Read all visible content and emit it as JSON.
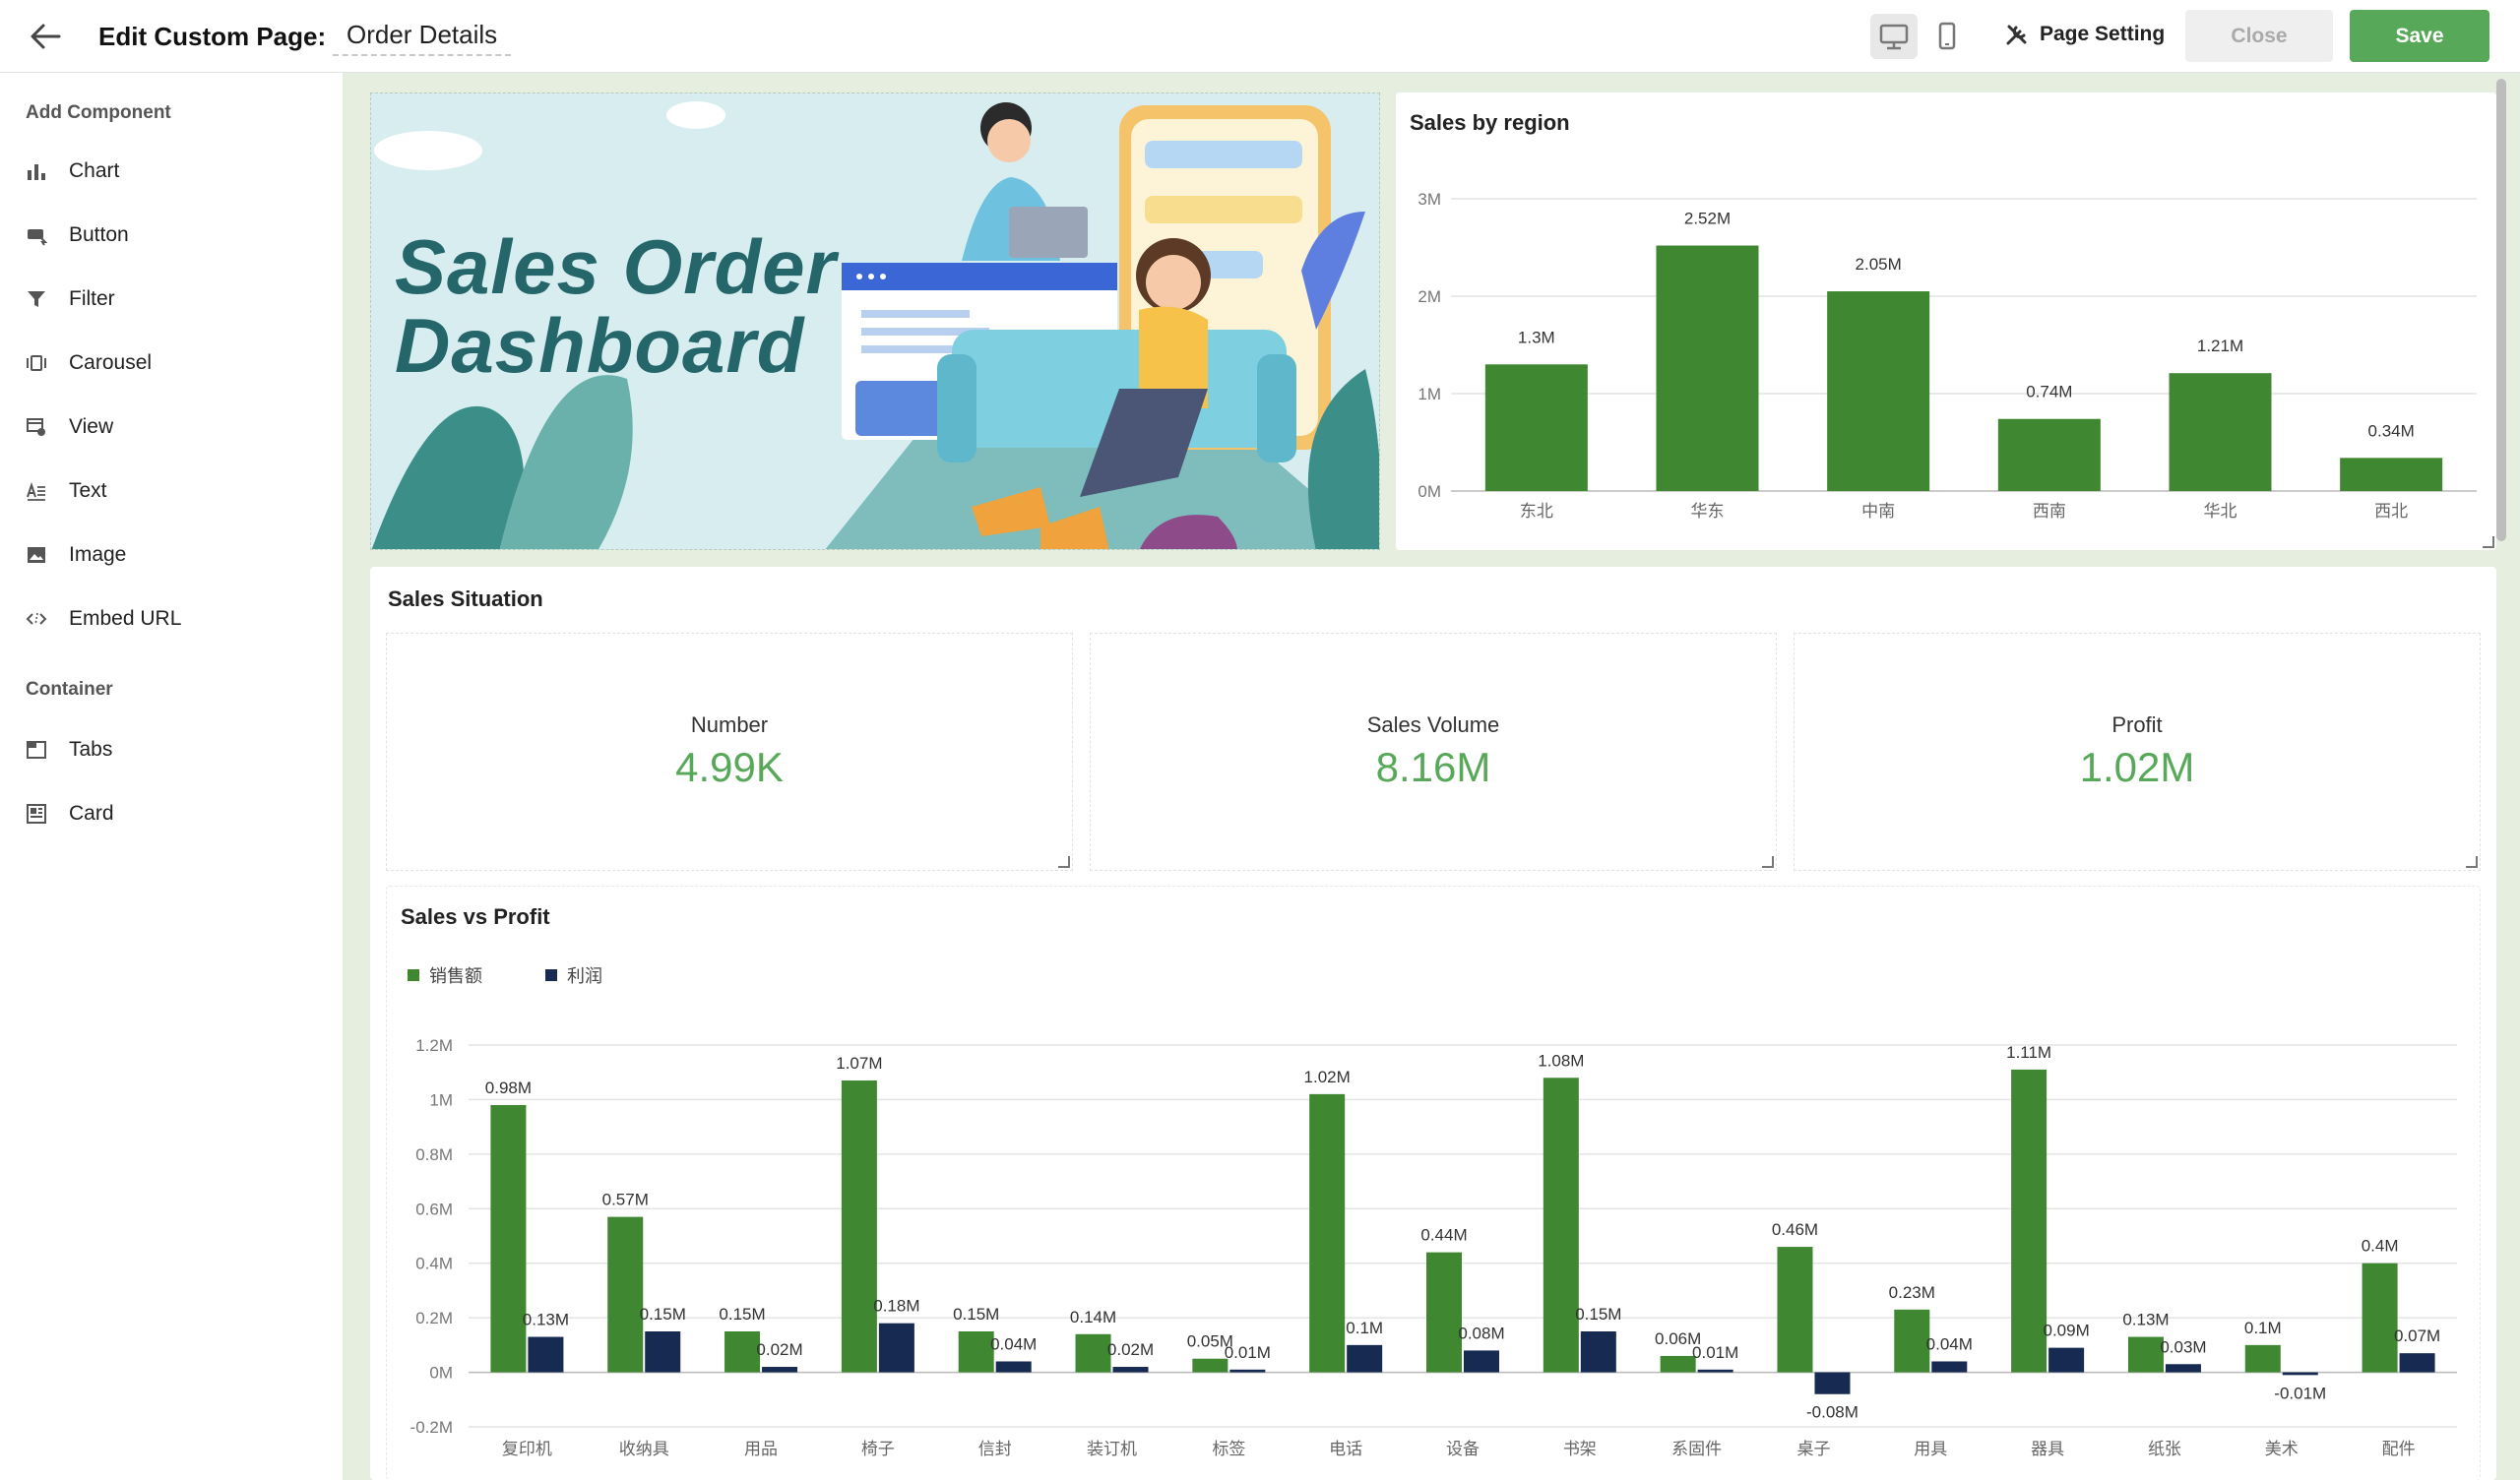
{
  "header": {
    "title_label": "Edit Custom Page:",
    "page_name": "Order Details",
    "page_setting_label": "Page Setting",
    "close_label": "Close",
    "save_label": "Save",
    "device_icons": [
      "desktop-icon",
      "mobile-icon"
    ]
  },
  "sidebar": {
    "add_component_heading": "Add Component",
    "components": [
      {
        "label": "Chart",
        "icon": "bar-chart-icon"
      },
      {
        "label": "Button",
        "icon": "button-icon"
      },
      {
        "label": "Filter",
        "icon": "filter-icon"
      },
      {
        "label": "Carousel",
        "icon": "carousel-icon"
      },
      {
        "label": "View",
        "icon": "view-icon"
      },
      {
        "label": "Text",
        "icon": "text-icon"
      },
      {
        "label": "Image",
        "icon": "image-icon"
      },
      {
        "label": "Embed URL",
        "icon": "code-icon"
      }
    ],
    "container_heading": "Container",
    "containers": [
      {
        "label": "Tabs",
        "icon": "tabs-icon"
      },
      {
        "label": "Card",
        "icon": "card-icon"
      }
    ]
  },
  "banner": {
    "title_line1": "Sales Order",
    "title_line2": "Dashboard"
  },
  "sales_situation": {
    "title": "Sales Situation",
    "metrics": [
      {
        "label": "Number",
        "value": "4.99K"
      },
      {
        "label": "Sales Volume",
        "value": "8.16M"
      },
      {
        "label": "Profit",
        "value": "1.02M"
      }
    ]
  },
  "colors": {
    "accent_green": "#58a85a",
    "bar_green": "#3f8731",
    "bar_navy": "#172b52"
  },
  "chart_data": [
    {
      "type": "bar",
      "title": "Sales by region",
      "categories": [
        "东北",
        "华东",
        "中南",
        "西南",
        "华北",
        "西北"
      ],
      "values": [
        1.3,
        2.52,
        2.05,
        0.74,
        1.21,
        0.34
      ],
      "data_labels": [
        "1.3M",
        "2.52M",
        "2.05M",
        "0.74M",
        "1.21M",
        "0.34M"
      ],
      "yticks": [
        "0M",
        "1M",
        "2M",
        "3M"
      ],
      "ylim": [
        0,
        3
      ],
      "grid": true
    },
    {
      "type": "bar",
      "title": "Sales vs Profit",
      "legend_position": "top-left",
      "categories": [
        "复印机",
        "收纳具",
        "用品",
        "椅子",
        "信封",
        "装订机",
        "标签",
        "电话",
        "设备",
        "书架",
        "系固件",
        "桌子",
        "用具",
        "器具",
        "纸张",
        "美术",
        "配件"
      ],
      "series": [
        {
          "name": "销售额",
          "values": [
            0.98,
            0.57,
            0.15,
            1.07,
            0.15,
            0.14,
            0.05,
            1.02,
            0.44,
            1.08,
            0.06,
            0.46,
            0.23,
            1.11,
            0.13,
            0.1,
            0.4
          ],
          "labels": [
            "0.98M",
            "0.57M",
            "0.15M",
            "1.07M",
            "0.15M",
            "0.14M",
            "0.05M",
            "1.02M",
            "0.44M",
            "1.08M",
            "0.06M",
            "0.46M",
            "0.23M",
            "1.11M",
            "0.13M",
            "0.1M",
            "0.4M"
          ]
        },
        {
          "name": "利润",
          "values": [
            0.13,
            0.15,
            0.02,
            0.18,
            0.04,
            0.02,
            0.01,
            0.1,
            0.08,
            0.15,
            0.01,
            -0.08,
            0.04,
            0.09,
            0.03,
            -0.01,
            0.07
          ],
          "labels": [
            "0.13M",
            "0.15M",
            "0.02M",
            "0.18M",
            "0.04M",
            "0.02M",
            "0.01M",
            "0.1M",
            "0.08M",
            "0.15M",
            "0.01M",
            "-0.08M",
            "0.04M",
            "0.09M",
            "0.03M",
            "-0.01M",
            "0.07M"
          ]
        }
      ],
      "yticks": [
        "-0.2M",
        "0M",
        "0.2M",
        "0.4M",
        "0.6M",
        "0.8M",
        "1M",
        "1.2M"
      ],
      "ylim": [
        -0.2,
        1.2
      ],
      "grid": true
    }
  ]
}
